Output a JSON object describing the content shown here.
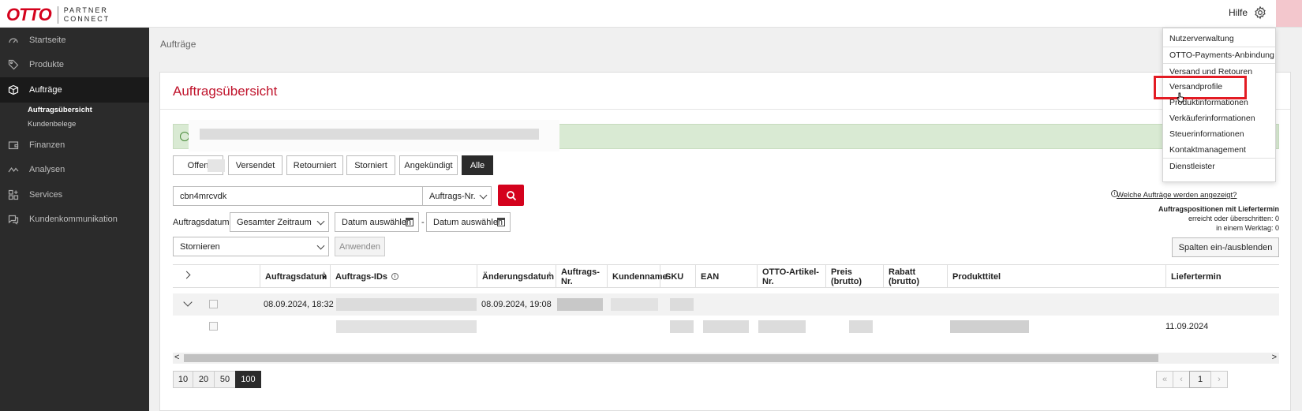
{
  "header": {
    "logo_brand": "OTTO",
    "logo_sub_line1": "PARTNER",
    "logo_sub_line2": "CONNECT",
    "help_label": "Hilfe"
  },
  "sidebar": {
    "items": [
      {
        "label": "Startseite",
        "icon": "speedometer-icon"
      },
      {
        "label": "Produkte",
        "icon": "tag-icon"
      },
      {
        "label": "Aufträge",
        "icon": "box-icon"
      },
      {
        "label": "Finanzen",
        "icon": "wallet-icon"
      },
      {
        "label": "Analysen",
        "icon": "chart-line-icon"
      },
      {
        "label": "Services",
        "icon": "grid-plus-icon"
      },
      {
        "label": "Kundenkommunikation",
        "icon": "chat-icon"
      }
    ],
    "sub_items": [
      "Auftragsübersicht",
      "Kundenbelege"
    ]
  },
  "breadcrumb": "Aufträge",
  "panel": {
    "title": "Auftragsübersicht",
    "tabs": [
      "Offen",
      "Versendet",
      "Retourniert",
      "Storniert",
      "Angekündigt",
      "Alle"
    ],
    "search": {
      "value": "cbn4mrcvdk",
      "type_selected": "Auftrags-Nr."
    },
    "filter": {
      "label": "Auftragsdatum",
      "range_selected": "Gesamter Zeitraum",
      "date_from_placeholder": "Datum auswählen",
      "date_sep": "-",
      "date_to_placeholder": "Datum auswählen"
    },
    "action": {
      "selected": "Stornieren",
      "apply_label": "Anwenden"
    },
    "info_link": "Welche Aufträge werden angezeigt?",
    "delivery_info": {
      "title": "Auftragspositionen mit Liefertermin",
      "line1": "erreicht oder überschritten: 0",
      "line2": "in einem Werktag: 0"
    },
    "columns_button": "Spalten ein-/ausblenden",
    "table": {
      "headers": [
        "Auftragsdatum",
        "Auftrags-IDs",
        "Änderungsdatum",
        "Auftrags-Nr.",
        "Kundenname",
        "SKU",
        "EAN",
        "OTTO-Artikel-Nr.",
        "Preis (brutto)",
        "Rabatt (brutto)",
        "Produkttitel",
        "Liefertermin"
      ],
      "row1": {
        "auftragsdatum": "08.09.2024, 18:32",
        "aenderungsdatum": "08.09.2024, 19:08"
      },
      "row2": {
        "liefertermin": "11.09.2024"
      }
    },
    "page_sizes": [
      "10",
      "20",
      "50",
      "100"
    ],
    "page_size_selected": "100",
    "pager": {
      "first": "«",
      "prev": "‹",
      "current": "1",
      "next": "›"
    }
  },
  "settings_menu": {
    "items": [
      "Nutzerverwaltung",
      "OTTO-Payments-Anbindung",
      "Versand und Retouren",
      "Versandprofile",
      "Produktinformationen",
      "Verkäuferinformationen",
      "Steuerinformationen",
      "Kontaktmanagement",
      "Dienstleister"
    ],
    "highlighted": "Versandprofile"
  },
  "colors": {
    "brand": "#d4021d",
    "sidebar": "#2b2b2b",
    "alert": "#d9ead3"
  }
}
